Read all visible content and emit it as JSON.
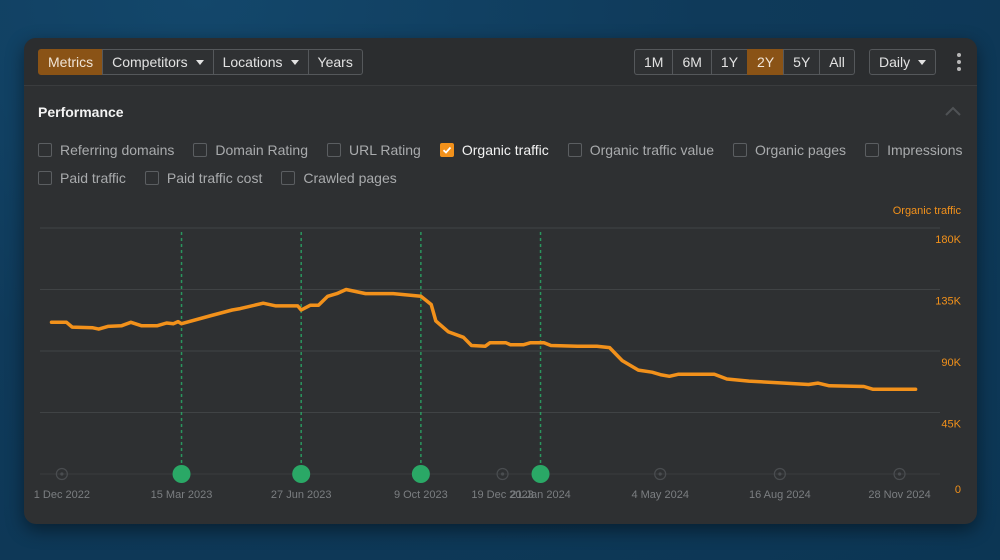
{
  "toolbar": {
    "left_tabs": [
      {
        "label": "Metrics",
        "active": true,
        "dropdown": false
      },
      {
        "label": "Competitors",
        "active": false,
        "dropdown": true
      },
      {
        "label": "Locations",
        "active": false,
        "dropdown": true
      },
      {
        "label": "Years",
        "active": false,
        "dropdown": false
      }
    ],
    "ranges": [
      {
        "label": "1M",
        "active": false
      },
      {
        "label": "6M",
        "active": false
      },
      {
        "label": "1Y",
        "active": false
      },
      {
        "label": "2Y",
        "active": true
      },
      {
        "label": "5Y",
        "active": false
      },
      {
        "label": "All",
        "active": false
      }
    ],
    "granularity": "Daily",
    "more_icon": "kebab-icon"
  },
  "section": {
    "title": "Performance",
    "collapse_icon": "chevron-up-icon"
  },
  "metrics": [
    [
      {
        "label": "Referring domains",
        "checked": false
      },
      {
        "label": "Domain Rating",
        "checked": false
      },
      {
        "label": "URL Rating",
        "checked": false
      },
      {
        "label": "Organic traffic",
        "checked": true
      },
      {
        "label": "Organic traffic value",
        "checked": false
      },
      {
        "label": "Organic pages",
        "checked": false
      },
      {
        "label": "Impressions",
        "checked": false
      }
    ],
    [
      {
        "label": "Paid traffic",
        "checked": false
      },
      {
        "label": "Paid traffic cost",
        "checked": false
      },
      {
        "label": "Crawled pages",
        "checked": false
      }
    ]
  ],
  "colors": {
    "accent": "#f2911b",
    "active_button": "#8a5316",
    "annotation": "#2aa866",
    "panel": "#2e3032",
    "background": "#0f3a5a"
  },
  "chart_data": {
    "type": "line",
    "title": "",
    "series": [
      {
        "name": "Organic traffic",
        "color": "#f2911b",
        "points": [
          [
            "2022-11-22",
            111000
          ],
          [
            "2022-12-05",
            111000
          ],
          [
            "2022-12-10",
            107500
          ],
          [
            "2022-12-28",
            107000
          ],
          [
            "2023-01-02",
            106000
          ],
          [
            "2023-01-10",
            108000
          ],
          [
            "2023-01-22",
            108500
          ],
          [
            "2023-01-30",
            111000
          ],
          [
            "2023-02-08",
            108500
          ],
          [
            "2023-02-22",
            108500
          ],
          [
            "2023-03-02",
            110500
          ],
          [
            "2023-03-08",
            110000
          ],
          [
            "2023-03-12",
            111500
          ],
          [
            "2023-03-15",
            110000
          ],
          [
            "2023-04-10",
            116000
          ],
          [
            "2023-04-28",
            120000
          ],
          [
            "2023-05-05",
            121000
          ],
          [
            "2023-05-25",
            125000
          ],
          [
            "2023-06-05",
            123000
          ],
          [
            "2023-06-24",
            123000
          ],
          [
            "2023-06-27",
            120000
          ],
          [
            "2023-07-05",
            123500
          ],
          [
            "2023-07-12",
            123500
          ],
          [
            "2023-07-20",
            130000
          ],
          [
            "2023-07-28",
            132000
          ],
          [
            "2023-08-05",
            135000
          ],
          [
            "2023-08-22",
            132000
          ],
          [
            "2023-09-15",
            132000
          ],
          [
            "2023-10-09",
            130000
          ],
          [
            "2023-10-18",
            124000
          ],
          [
            "2023-10-22",
            112000
          ],
          [
            "2023-11-02",
            104000
          ],
          [
            "2023-11-15",
            100000
          ],
          [
            "2023-11-22",
            94000
          ],
          [
            "2023-12-04",
            93500
          ],
          [
            "2023-12-08",
            96000
          ],
          [
            "2023-12-22",
            96000
          ],
          [
            "2023-12-26",
            94500
          ],
          [
            "2024-01-06",
            94500
          ],
          [
            "2024-01-12",
            96000
          ],
          [
            "2024-01-24",
            96000
          ],
          [
            "2024-01-30",
            94000
          ],
          [
            "2024-02-22",
            93500
          ],
          [
            "2024-03-10",
            93500
          ],
          [
            "2024-03-21",
            92500
          ],
          [
            "2024-04-01",
            83000
          ],
          [
            "2024-04-15",
            76000
          ],
          [
            "2024-04-27",
            74500
          ],
          [
            "2024-05-05",
            72500
          ],
          [
            "2024-05-12",
            71500
          ],
          [
            "2024-05-20",
            73000
          ],
          [
            "2024-06-20",
            73000
          ],
          [
            "2024-07-01",
            69500
          ],
          [
            "2024-07-20",
            68000
          ],
          [
            "2024-08-20",
            66500
          ],
          [
            "2024-09-10",
            65500
          ],
          [
            "2024-09-18",
            66500
          ],
          [
            "2024-09-28",
            64500
          ],
          [
            "2024-10-28",
            64000
          ],
          [
            "2024-11-05",
            62000
          ],
          [
            "2024-12-12",
            62000
          ]
        ]
      }
    ],
    "x_ticks": [
      {
        "date": "2022-12-01",
        "label": "1 Dec 2022"
      },
      {
        "date": "2023-03-15",
        "label": "15 Mar 2023"
      },
      {
        "date": "2023-06-27",
        "label": "27 Jun 2023"
      },
      {
        "date": "2023-10-09",
        "label": "9 Oct 2023"
      },
      {
        "date": "2023-12-19",
        "label": "19 Dec 2023"
      },
      {
        "date": "2024-01-21",
        "label": "21 Jan 2024"
      },
      {
        "date": "2024-05-04",
        "label": "4 May 2024"
      },
      {
        "date": "2024-08-16",
        "label": "16 Aug 2024"
      },
      {
        "date": "2024-11-28",
        "label": "28 Nov 2024"
      }
    ],
    "annotations": [
      {
        "date": "2023-03-15",
        "label": "15 Mar 2023"
      },
      {
        "date": "2023-06-27",
        "label": "27 Jun 2023"
      },
      {
        "date": "2023-10-09",
        "label": "9 Oct 2023"
      },
      {
        "date": "2024-01-21",
        "label": "21 Jan 2024"
      }
    ],
    "y_axis": {
      "label": "Organic traffic",
      "position": "right",
      "ticks": [
        0,
        45000,
        90000,
        135000,
        180000
      ],
      "tick_labels": [
        "0",
        "45K",
        "90K",
        "135K",
        "180K"
      ],
      "ylim": [
        0,
        180000
      ]
    },
    "x_range": [
      "2022-11-12",
      "2024-12-21"
    ],
    "grid": true,
    "legend": "none"
  }
}
